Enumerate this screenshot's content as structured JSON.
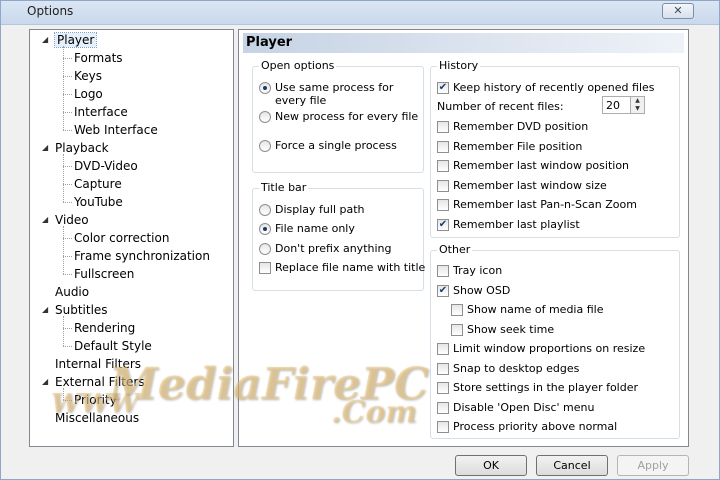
{
  "window": {
    "title": "Options",
    "close_glyph": "✕"
  },
  "tree": {
    "items": [
      {
        "label": "Player",
        "level": 0,
        "expander": "◢",
        "selected": true
      },
      {
        "label": "Formats",
        "level": 1
      },
      {
        "label": "Keys",
        "level": 1
      },
      {
        "label": "Logo",
        "level": 1
      },
      {
        "label": "Interface",
        "level": 1
      },
      {
        "label": "Web Interface",
        "level": 1
      },
      {
        "label": "Playback",
        "level": 0,
        "expander": "◢"
      },
      {
        "label": "DVD-Video",
        "level": 1
      },
      {
        "label": "Capture",
        "level": 1
      },
      {
        "label": "YouTube",
        "level": 1
      },
      {
        "label": "Video",
        "level": 0,
        "expander": "◢"
      },
      {
        "label": "Color correction",
        "level": 1
      },
      {
        "label": "Frame synchronization",
        "level": 1
      },
      {
        "label": "Fullscreen",
        "level": 1
      },
      {
        "label": "Audio",
        "level": 0
      },
      {
        "label": "Subtitles",
        "level": 0,
        "expander": "◢"
      },
      {
        "label": "Rendering",
        "level": 1
      },
      {
        "label": "Default Style",
        "level": 1
      },
      {
        "label": "Internal Filters",
        "level": 0
      },
      {
        "label": "External Filters",
        "level": 0,
        "expander": "◢"
      },
      {
        "label": "Priority",
        "level": 1
      },
      {
        "label": "Miscellaneous",
        "level": 0
      }
    ]
  },
  "panel": {
    "header": "Player",
    "open_options": {
      "title": "Open options",
      "options": [
        {
          "label": "Use same process for every file",
          "checked": true
        },
        {
          "label": "New process for every file",
          "checked": false
        },
        {
          "label": "Force a single process",
          "checked": false
        }
      ]
    },
    "title_bar": {
      "title": "Title bar",
      "radios": [
        {
          "label": "Display full path",
          "checked": false
        },
        {
          "label": "File name only",
          "checked": true
        },
        {
          "label": "Don't prefix anything",
          "checked": false
        }
      ],
      "checkbox": {
        "label": "Replace file name with title",
        "checked": false
      }
    },
    "history": {
      "title": "History",
      "keep_history": {
        "label": "Keep history of recently opened files",
        "checked": true
      },
      "recent_files_label": "Number of recent files:",
      "recent_files_value": "20",
      "items": [
        {
          "label": "Remember DVD position",
          "checked": false
        },
        {
          "label": "Remember File position",
          "checked": false
        },
        {
          "label": "Remember last window position",
          "checked": false
        },
        {
          "label": "Remember last window size",
          "checked": false
        },
        {
          "label": "Remember last Pan-n-Scan Zoom",
          "checked": false
        },
        {
          "label": "Remember last playlist",
          "checked": true
        }
      ]
    },
    "other": {
      "title": "Other",
      "items": [
        {
          "label": "Tray icon",
          "checked": false,
          "indent": 0
        },
        {
          "label": "Show OSD",
          "checked": true,
          "indent": 0
        },
        {
          "label": "Show name of media file",
          "checked": false,
          "indent": 1
        },
        {
          "label": "Show seek time",
          "checked": false,
          "indent": 1
        },
        {
          "label": "Limit window proportions on resize",
          "checked": false,
          "indent": 0
        },
        {
          "label": "Snap to desktop edges",
          "checked": false,
          "indent": 0
        },
        {
          "label": "Store settings in the player folder",
          "checked": false,
          "indent": 0
        },
        {
          "label": "Disable 'Open Disc' menu",
          "checked": false,
          "indent": 0
        },
        {
          "label": "Process priority above normal",
          "checked": false,
          "indent": 0
        }
      ]
    }
  },
  "buttons": {
    "ok": "OK",
    "cancel": "Cancel",
    "apply": "Apply"
  },
  "watermark": {
    "line1": "MediaFirePC",
    "line2": ".Com",
    "prefix": "WWW"
  },
  "colors": {
    "check_mark": "#1a3d6c",
    "header_gradient_start": "#c6d3e4"
  }
}
